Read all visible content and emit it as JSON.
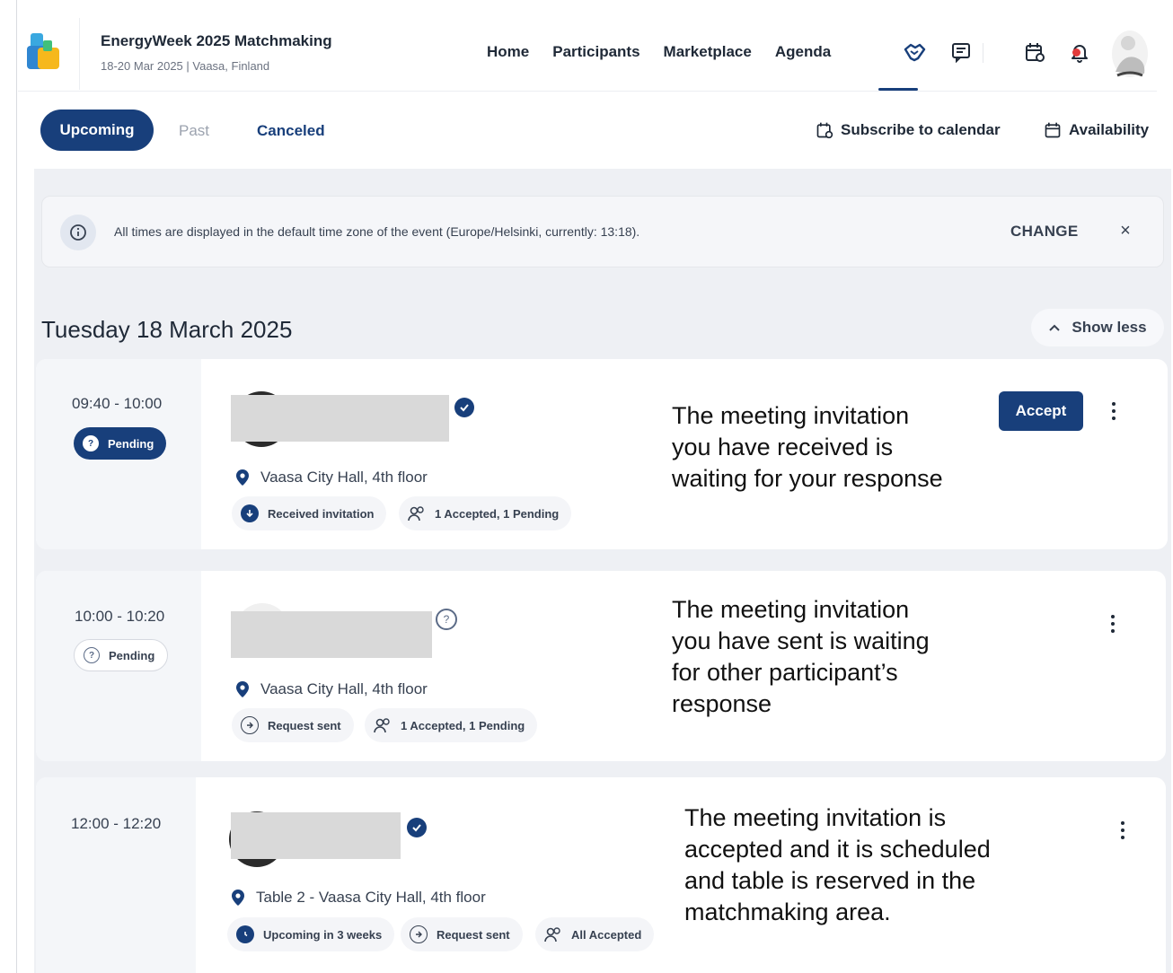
{
  "header": {
    "event_title": "EnergyWeek 2025 Matchmaking",
    "event_subtitle": "18-20 Mar 2025 | Vaasa, Finland",
    "nav": [
      {
        "label": "Home"
      },
      {
        "label": "Participants"
      },
      {
        "label": "Marketplace"
      },
      {
        "label": "Agenda"
      }
    ],
    "icons": [
      "meetings-handshake-icon",
      "chat-icon",
      "calendar-sync-icon",
      "bell-icon",
      "user-avatar"
    ],
    "accent_color": "#183f7b"
  },
  "tabs": {
    "upcoming": "Upcoming",
    "past": "Past",
    "canceled": "Canceled",
    "selected": "Upcoming"
  },
  "actions": {
    "subscribe": "Subscribe to calendar",
    "availability": "Availability"
  },
  "banner": {
    "text": "All times are displayed in the default time zone of the event (Europe/Helsinki, currently: 13:18).",
    "change": "CHANGE",
    "close": "×"
  },
  "day": {
    "title": "Tuesday 18 March 2025",
    "show_less": "Show less"
  },
  "meetings": [
    {
      "time": "09:40 - 10:00",
      "status": "Pending",
      "location": "Vaasa City Hall, 4th floor",
      "tags": [
        "Received invitation",
        "1 Accepted, 1 Pending"
      ],
      "accept_label": "Accept",
      "note": [
        "The meeting invitation",
        "you have received is",
        "waiting for your response"
      ]
    },
    {
      "time": "10:00 - 10:20",
      "status": "Pending",
      "location": "Vaasa City Hall, 4th floor",
      "tags": [
        "Request sent",
        "1 Accepted, 1 Pending"
      ],
      "note": [
        "The meeting invitation",
        "you have sent is waiting",
        "for other participant’s",
        "response"
      ]
    },
    {
      "time": "12:00 - 12:20",
      "location": "Table 2 - Vaasa City Hall, 4th floor",
      "tags": [
        "Upcoming in 3 weeks",
        "Request sent",
        "All Accepted"
      ],
      "note": [
        "The meeting invitation is",
        "accepted and it is scheduled",
        "and table is reserved in the",
        "matchmaking area."
      ]
    }
  ]
}
